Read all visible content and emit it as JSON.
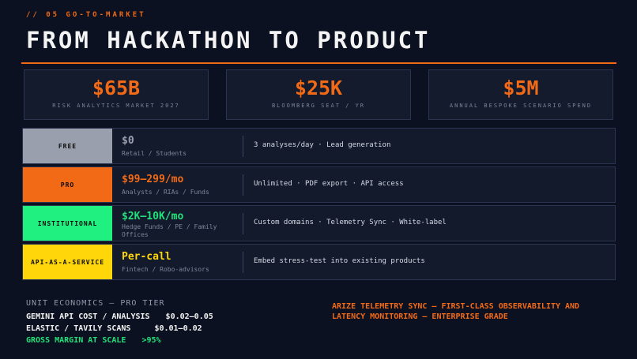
{
  "eyebrow": "// 05 GO-TO-MARKET",
  "title": "FROM HACKATHON TO PRODUCT",
  "stats": [
    {
      "value": "$65B",
      "label": "RISK ANALYTICS MARKET 2027"
    },
    {
      "value": "$25K",
      "label": "BLOOMBERG SEAT / YR"
    },
    {
      "value": "$5M",
      "label": "ANNUAL BESPOKE SCENARIO SPEND"
    }
  ],
  "tiers": [
    {
      "name": "FREE",
      "price": "$0",
      "audience": "Retail / Students",
      "features": "3 analyses/day  ·  Lead generation",
      "badge_color": "#9a9fae",
      "price_color": "#9aa0ad"
    },
    {
      "name": "PRO",
      "price": "$99–299/mo",
      "audience": "Analysts / RIAs / Funds",
      "features": "Unlimited  ·  PDF export  ·  API access",
      "badge_color": "#f26a16",
      "price_color": "#f26a16"
    },
    {
      "name": "INSTITUTIONAL",
      "price": "$2K–10K/mo",
      "audience": "Hedge Funds / PE / Family Offices",
      "features": "Custom domains  ·  Telemetry Sync  ·  White-label",
      "badge_color": "#1ff07f",
      "price_color": "#22e07a"
    },
    {
      "name": "API-AS-A-SERVICE",
      "price": "Per-call",
      "audience": "Fintech / Robo-advisors",
      "features": "Embed stress-test into existing products",
      "badge_color": "#ffd60a",
      "price_color": "#ffd60a"
    }
  ],
  "unit_economics": {
    "heading": "UNIT ECONOMICS — PRO TIER",
    "rows": [
      {
        "label": "GEMINI API COST / ANALYSIS",
        "value": "$0.02–0.05"
      },
      {
        "label": "ELASTIC / TAVILY SCANS",
        "value": "$0.01–0.02"
      },
      {
        "label": "GROSS MARGIN AT SCALE",
        "value": ">95%"
      }
    ]
  },
  "arize_note": "ARIZE TELEMETRY SYNC — FIRST-CLASS OBSERVABILITY AND LATENCY MONITORING — ENTERPRISE GRADE"
}
